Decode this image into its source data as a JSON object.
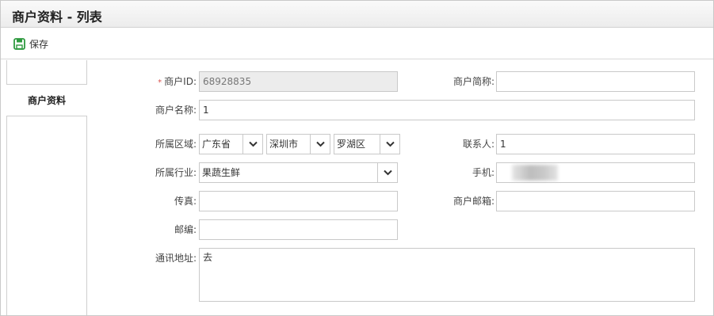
{
  "header": {
    "title": "商户资料 - 列表"
  },
  "toolbar": {
    "save_label": "保存"
  },
  "nav": {
    "tabs": [
      {
        "label": "商户资料"
      }
    ]
  },
  "form": {
    "merchant_id": {
      "label": "商户ID:",
      "required_mark": "*",
      "value": "68928835"
    },
    "merchant_short_name": {
      "label": "商户简称:",
      "value": ""
    },
    "merchant_name": {
      "label": "商户名称:",
      "value": "1"
    },
    "region": {
      "label": "所属区域:",
      "province": "广东省",
      "city": "深圳市",
      "district": "罗湖区"
    },
    "contact": {
      "label": "联系人:",
      "value": "1"
    },
    "industry": {
      "label": "所属行业:",
      "value": "果蔬生鲜"
    },
    "phone": {
      "label": "手机:",
      "value": ""
    },
    "fax": {
      "label": "传真:",
      "value": ""
    },
    "email": {
      "label": "商户邮箱:",
      "value": ""
    },
    "postcode": {
      "label": "邮编:",
      "value": ""
    },
    "address": {
      "label": "通讯地址:",
      "value": "去"
    }
  },
  "colors": {
    "save_icon": "#2e9a3f",
    "required": "#d9534f",
    "readonly_bg": "#ececec"
  }
}
